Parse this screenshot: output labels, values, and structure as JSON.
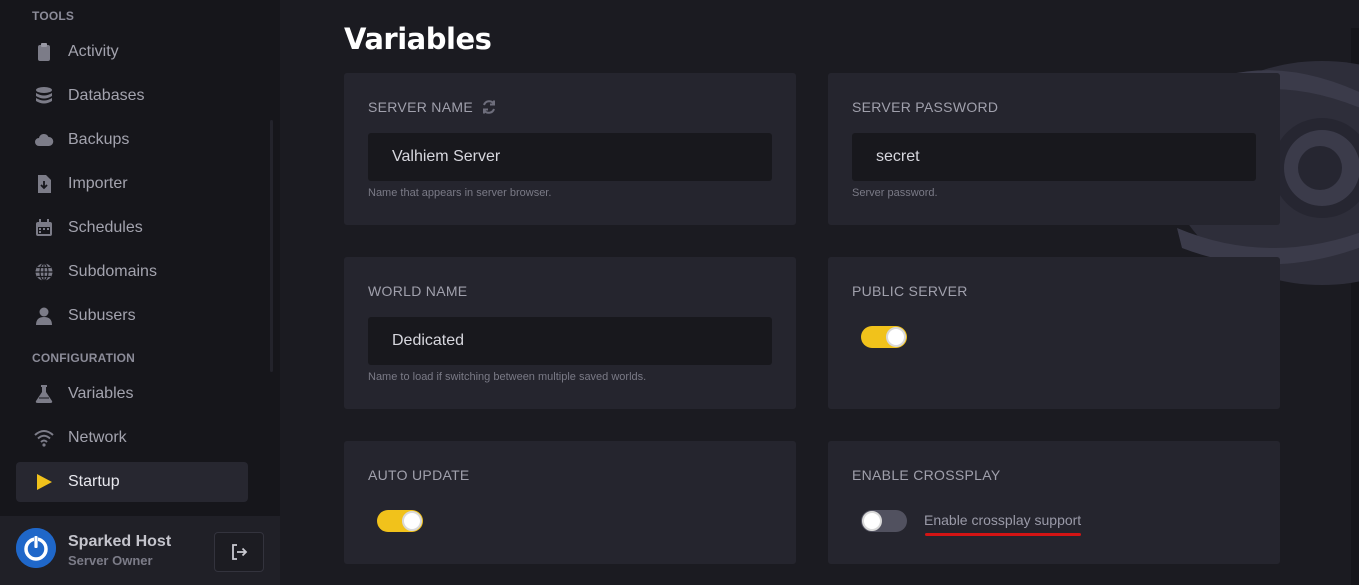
{
  "sidebar": {
    "sections": {
      "tools": "TOOLS",
      "configuration": "CONFIGURATION"
    },
    "items": [
      {
        "label": "Activity",
        "icon": "clipboard-icon"
      },
      {
        "label": "Databases",
        "icon": "database-icon"
      },
      {
        "label": "Backups",
        "icon": "cloud-icon"
      },
      {
        "label": "Importer",
        "icon": "file-download-icon"
      },
      {
        "label": "Schedules",
        "icon": "calendar-icon"
      },
      {
        "label": "Subdomains",
        "icon": "globe-icon"
      },
      {
        "label": "Subusers",
        "icon": "user-icon"
      },
      {
        "label": "Variables",
        "icon": "flask-icon"
      },
      {
        "label": "Network",
        "icon": "wifi-icon"
      },
      {
        "label": "Startup",
        "icon": "play-icon",
        "active": true
      }
    ],
    "user": {
      "name": "Sparked Host",
      "role": "Server Owner"
    }
  },
  "main": {
    "title": "Variables",
    "cards": {
      "server_name": {
        "label": "SERVER NAME",
        "value": "Valhiem Server",
        "help": "Name that appears in server browser."
      },
      "server_password": {
        "label": "SERVER PASSWORD",
        "value": "secret",
        "help": "Server password."
      },
      "world_name": {
        "label": "WORLD NAME",
        "value": "Dedicated",
        "help": "Name to load if switching between multiple saved worlds."
      },
      "public_server": {
        "label": "PUBLIC SERVER",
        "enabled": true
      },
      "auto_update": {
        "label": "AUTO UPDATE",
        "enabled": true
      },
      "enable_crossplay": {
        "label": "ENABLE CROSSPLAY",
        "enabled": false,
        "toggle_text": "Enable crossplay support"
      }
    }
  },
  "colors": {
    "accent": "#f1c21b",
    "annotation": "#d31414",
    "avatar": "#1f67c9"
  }
}
